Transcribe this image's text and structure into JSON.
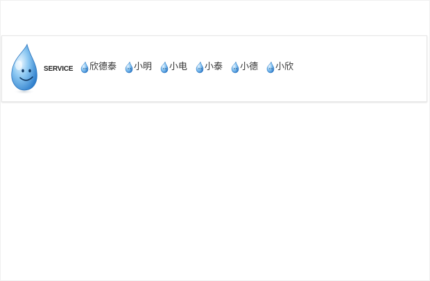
{
  "service_bar": {
    "label": "SERVICE",
    "mascot_icon": "qq-penguin-mascot-icon",
    "contacts": [
      {
        "name": "欣德泰",
        "icon": "qq-chat-icon"
      },
      {
        "name": "小明",
        "icon": "qq-chat-icon"
      },
      {
        "name": "小电",
        "icon": "qq-chat-icon"
      },
      {
        "name": "小泰",
        "icon": "qq-chat-icon"
      },
      {
        "name": "小德",
        "icon": "qq-chat-icon"
      },
      {
        "name": "小欣",
        "icon": "qq-chat-icon"
      }
    ]
  },
  "colors": {
    "mascot_blue": "#3a8fd8",
    "mascot_light": "#bfe2fb",
    "text": "#333333"
  }
}
